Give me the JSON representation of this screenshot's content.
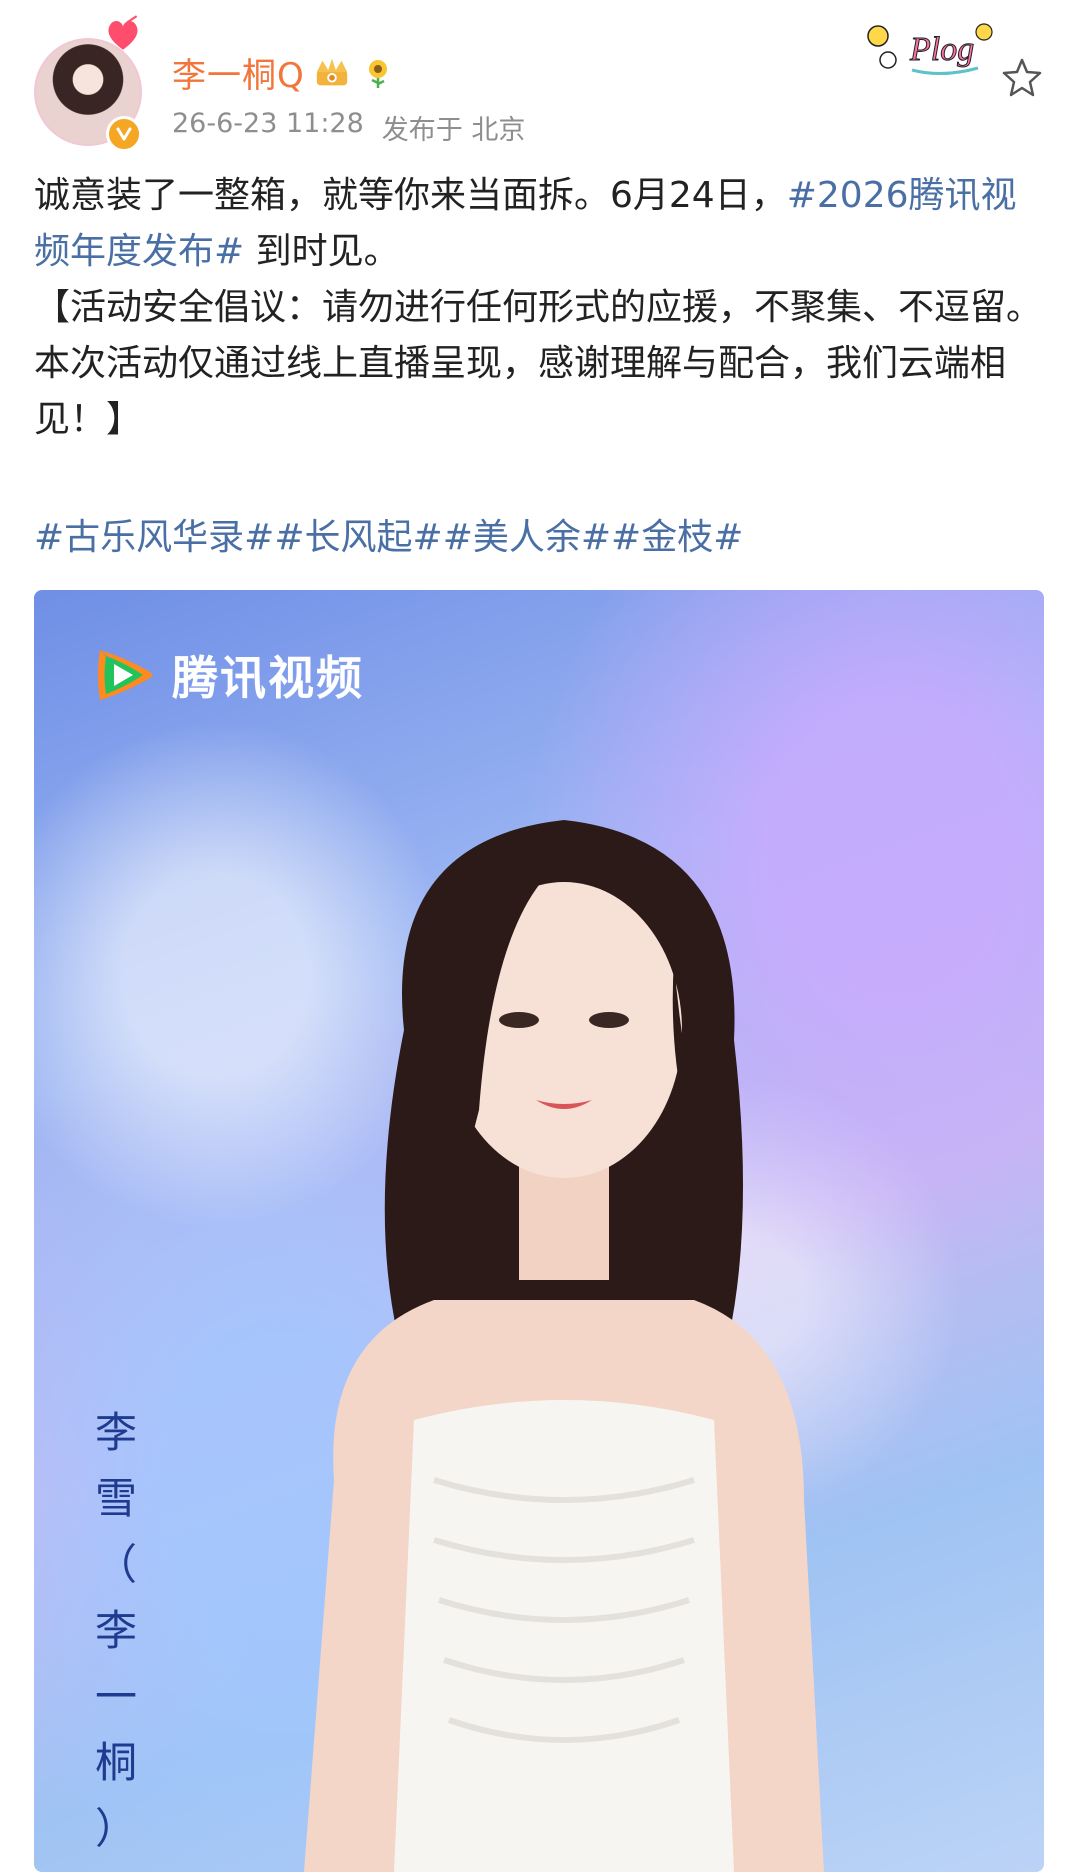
{
  "post": {
    "username": "李一桐Q",
    "timestamp": "26-6-23 11:28",
    "location": "发布于 北京",
    "deco_text": "Plog",
    "body": {
      "line1_prefix": "诚意装了一整箱，就等你来当面拆。6月24日，",
      "hashtag_event": "#2026腾讯视频年度发布#",
      "line1_suffix": " 到时见。",
      "notice": "【活动安全倡议：请勿进行任何形式的应援，不聚集、不逗留。本次活动仅通过线上直播呈现，感谢理解与配合，我们云端相见！】"
    },
    "tags": [
      "#古乐风华录#",
      "#长风起#",
      "#美人余#",
      "#金枝#"
    ]
  },
  "image": {
    "logo_text": "腾讯视频",
    "caption_chars": [
      "李",
      "雪",
      "（",
      "李",
      "一",
      "桐",
      "）"
    ]
  },
  "colors": {
    "username": "#f2763b",
    "link": "#4a6fa5",
    "meta": "#8e8e8e",
    "text": "#222222",
    "badge": "#f5a623"
  },
  "icons": {
    "favorite": "star-outline-icon",
    "verified": "verified-badge-icon",
    "crown": "crown-icon",
    "flower": "sunflower-icon"
  }
}
